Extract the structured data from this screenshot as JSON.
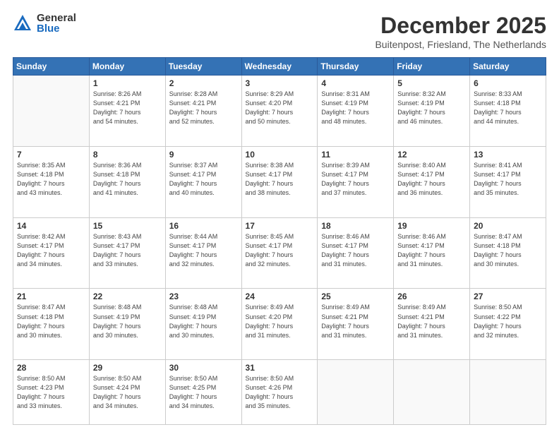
{
  "logo": {
    "general": "General",
    "blue": "Blue"
  },
  "title": {
    "month": "December 2025",
    "location": "Buitenpost, Friesland, The Netherlands"
  },
  "weekdays": [
    "Sunday",
    "Monday",
    "Tuesday",
    "Wednesday",
    "Thursday",
    "Friday",
    "Saturday"
  ],
  "weeks": [
    [
      {
        "day": "",
        "info": ""
      },
      {
        "day": "1",
        "info": "Sunrise: 8:26 AM\nSunset: 4:21 PM\nDaylight: 7 hours\nand 54 minutes."
      },
      {
        "day": "2",
        "info": "Sunrise: 8:28 AM\nSunset: 4:21 PM\nDaylight: 7 hours\nand 52 minutes."
      },
      {
        "day": "3",
        "info": "Sunrise: 8:29 AM\nSunset: 4:20 PM\nDaylight: 7 hours\nand 50 minutes."
      },
      {
        "day": "4",
        "info": "Sunrise: 8:31 AM\nSunset: 4:19 PM\nDaylight: 7 hours\nand 48 minutes."
      },
      {
        "day": "5",
        "info": "Sunrise: 8:32 AM\nSunset: 4:19 PM\nDaylight: 7 hours\nand 46 minutes."
      },
      {
        "day": "6",
        "info": "Sunrise: 8:33 AM\nSunset: 4:18 PM\nDaylight: 7 hours\nand 44 minutes."
      }
    ],
    [
      {
        "day": "7",
        "info": "Sunrise: 8:35 AM\nSunset: 4:18 PM\nDaylight: 7 hours\nand 43 minutes."
      },
      {
        "day": "8",
        "info": "Sunrise: 8:36 AM\nSunset: 4:18 PM\nDaylight: 7 hours\nand 41 minutes."
      },
      {
        "day": "9",
        "info": "Sunrise: 8:37 AM\nSunset: 4:17 PM\nDaylight: 7 hours\nand 40 minutes."
      },
      {
        "day": "10",
        "info": "Sunrise: 8:38 AM\nSunset: 4:17 PM\nDaylight: 7 hours\nand 38 minutes."
      },
      {
        "day": "11",
        "info": "Sunrise: 8:39 AM\nSunset: 4:17 PM\nDaylight: 7 hours\nand 37 minutes."
      },
      {
        "day": "12",
        "info": "Sunrise: 8:40 AM\nSunset: 4:17 PM\nDaylight: 7 hours\nand 36 minutes."
      },
      {
        "day": "13",
        "info": "Sunrise: 8:41 AM\nSunset: 4:17 PM\nDaylight: 7 hours\nand 35 minutes."
      }
    ],
    [
      {
        "day": "14",
        "info": "Sunrise: 8:42 AM\nSunset: 4:17 PM\nDaylight: 7 hours\nand 34 minutes."
      },
      {
        "day": "15",
        "info": "Sunrise: 8:43 AM\nSunset: 4:17 PM\nDaylight: 7 hours\nand 33 minutes."
      },
      {
        "day": "16",
        "info": "Sunrise: 8:44 AM\nSunset: 4:17 PM\nDaylight: 7 hours\nand 32 minutes."
      },
      {
        "day": "17",
        "info": "Sunrise: 8:45 AM\nSunset: 4:17 PM\nDaylight: 7 hours\nand 32 minutes."
      },
      {
        "day": "18",
        "info": "Sunrise: 8:46 AM\nSunset: 4:17 PM\nDaylight: 7 hours\nand 31 minutes."
      },
      {
        "day": "19",
        "info": "Sunrise: 8:46 AM\nSunset: 4:17 PM\nDaylight: 7 hours\nand 31 minutes."
      },
      {
        "day": "20",
        "info": "Sunrise: 8:47 AM\nSunset: 4:18 PM\nDaylight: 7 hours\nand 30 minutes."
      }
    ],
    [
      {
        "day": "21",
        "info": "Sunrise: 8:47 AM\nSunset: 4:18 PM\nDaylight: 7 hours\nand 30 minutes."
      },
      {
        "day": "22",
        "info": "Sunrise: 8:48 AM\nSunset: 4:19 PM\nDaylight: 7 hours\nand 30 minutes."
      },
      {
        "day": "23",
        "info": "Sunrise: 8:48 AM\nSunset: 4:19 PM\nDaylight: 7 hours\nand 30 minutes."
      },
      {
        "day": "24",
        "info": "Sunrise: 8:49 AM\nSunset: 4:20 PM\nDaylight: 7 hours\nand 31 minutes."
      },
      {
        "day": "25",
        "info": "Sunrise: 8:49 AM\nSunset: 4:21 PM\nDaylight: 7 hours\nand 31 minutes."
      },
      {
        "day": "26",
        "info": "Sunrise: 8:49 AM\nSunset: 4:21 PM\nDaylight: 7 hours\nand 31 minutes."
      },
      {
        "day": "27",
        "info": "Sunrise: 8:50 AM\nSunset: 4:22 PM\nDaylight: 7 hours\nand 32 minutes."
      }
    ],
    [
      {
        "day": "28",
        "info": "Sunrise: 8:50 AM\nSunset: 4:23 PM\nDaylight: 7 hours\nand 33 minutes."
      },
      {
        "day": "29",
        "info": "Sunrise: 8:50 AM\nSunset: 4:24 PM\nDaylight: 7 hours\nand 34 minutes."
      },
      {
        "day": "30",
        "info": "Sunrise: 8:50 AM\nSunset: 4:25 PM\nDaylight: 7 hours\nand 34 minutes."
      },
      {
        "day": "31",
        "info": "Sunrise: 8:50 AM\nSunset: 4:26 PM\nDaylight: 7 hours\nand 35 minutes."
      },
      {
        "day": "",
        "info": ""
      },
      {
        "day": "",
        "info": ""
      },
      {
        "day": "",
        "info": ""
      }
    ]
  ]
}
